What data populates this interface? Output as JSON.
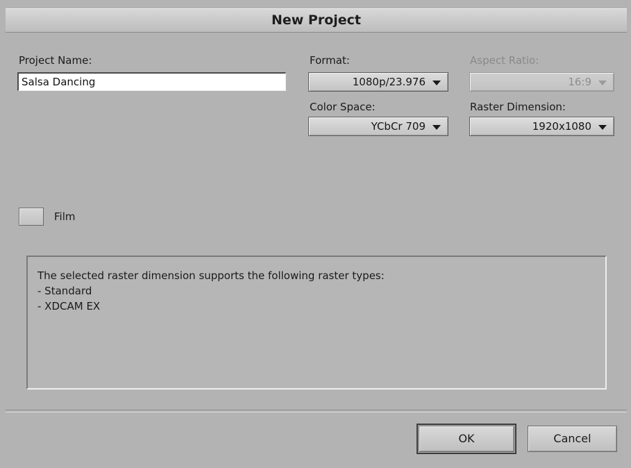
{
  "window": {
    "title": "New Project"
  },
  "project_name": {
    "label": "Project Name:",
    "value": "Salsa Dancing"
  },
  "format": {
    "label": "Format:",
    "selected": "1080p/23.976"
  },
  "aspect_ratio": {
    "label": "Aspect Ratio:",
    "selected": "16:9",
    "enabled": false
  },
  "color_space": {
    "label": "Color Space:",
    "selected": "YCbCr 709"
  },
  "raster_dimension": {
    "label": "Raster Dimension:",
    "selected": "1920x1080"
  },
  "film": {
    "label": "Film",
    "checked": false
  },
  "info": {
    "heading": "The selected raster dimension supports the following raster types:",
    "items": [
      "- Standard",
      "- XDCAM EX"
    ]
  },
  "buttons": {
    "ok": "OK",
    "cancel": "Cancel"
  },
  "colors": {
    "dialog_background": "#b3b3b3",
    "title_text": "#1e1e1e",
    "disabled_text": "#8a8a8a"
  },
  "icons": {
    "dropdown": "triangle-down-icon"
  }
}
